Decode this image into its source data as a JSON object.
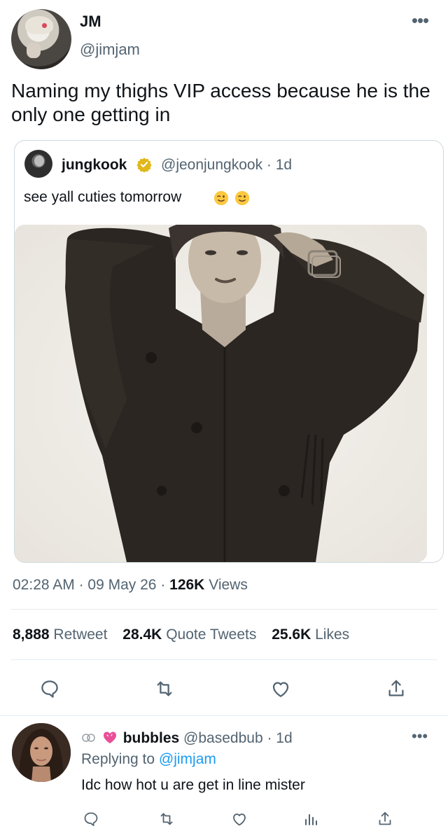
{
  "main_tweet": {
    "author_name": "JM",
    "author_handle": "@jimjam",
    "more_label": "•••",
    "text": "Naming my thighs VIP access because he is the only one getting in"
  },
  "quoted_tweet": {
    "author_name": "jungkook",
    "author_handle": "@jeonjungkook · 1d",
    "text": "see yall cuties tomorrow",
    "emoji": [
      "winking-face",
      "winking-face"
    ]
  },
  "meta": {
    "time": "02:28 AM",
    "date": "09 May 26",
    "views_count": "126K",
    "views_label": "Views"
  },
  "stats": {
    "retweets_count": "8,888",
    "retweets_label": "Retweet",
    "quotes_count": "28.4K",
    "quotes_label": "Quote Tweets",
    "likes_count": "25.6K",
    "likes_label": "Likes"
  },
  "actions": [
    "reply-icon",
    "retweet-icon",
    "like-icon",
    "share-icon"
  ],
  "reply": {
    "badges": [
      "link-icon",
      "heart-emoji"
    ],
    "author_name": "bubbles",
    "author_handle": "@basedbub · 1d",
    "replying_to_label": "Replying to",
    "replying_to_handle": "@jimjam",
    "text": "Idc how hot u are get in line mister",
    "more_label": "•••",
    "actions": [
      "reply-icon",
      "retweet-icon",
      "like-icon",
      "analytics-icon",
      "share-icon"
    ]
  },
  "colors": {
    "text_primary": "#0f1419",
    "text_secondary": "#536471",
    "link": "#1d9bf0",
    "verified_gold": "#e2b719",
    "divider": "#e6ecf0",
    "heart_pink": "#e94e98"
  }
}
